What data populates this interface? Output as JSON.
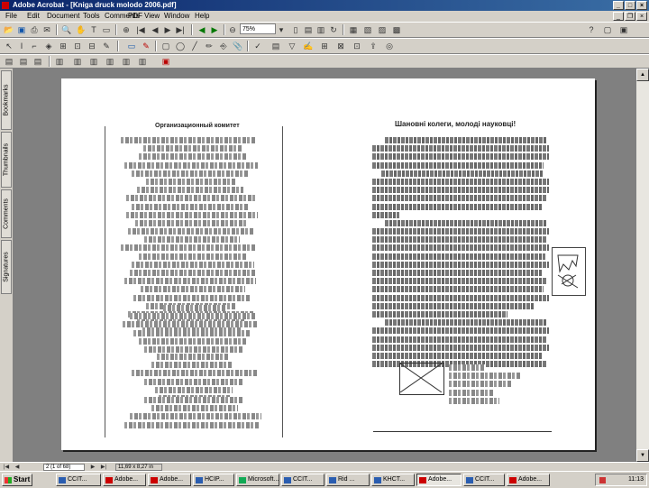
{
  "window": {
    "title": "Adobe Acrobat - [Kniga druck molodo 2006.pdf]"
  },
  "menu": {
    "items": [
      "File",
      "Edit",
      "Document",
      "Tools",
      "Comments",
      "PDF",
      "View",
      "Window",
      "Help"
    ]
  },
  "toolbar": {
    "zoom": "75%"
  },
  "tabs": [
    "Bookmarks",
    "Thumbnails",
    "Comments",
    "Signatures"
  ],
  "document": {
    "left_title": "Организационный комитет",
    "right_title": "Шановні колеги, молоді науковці!",
    "left_para_1": "Голова — Перший Проректор з наукової роботи НТУ «ХПІ» ...",
    "right_intro": "Цю книжку відкриває наукова конференція студентів ...",
    "signature": "Дорогий колега, з повагою, ректор НТУ «ХПІ»"
  },
  "status": {
    "page": "2 (1 of 68)",
    "size": "11,69 x 8,27 in"
  },
  "taskbar": {
    "start": "Start",
    "tasks": [
      "CCIT...",
      "Adobe...",
      "Adobe...",
      "HCIP...",
      "Microsoft...",
      "CCIT...",
      "Rid ...",
      "KHCT...",
      "Adobe...",
      "CCIT...",
      "Adobe..."
    ],
    "active_task": 8,
    "clock": "11:13"
  }
}
